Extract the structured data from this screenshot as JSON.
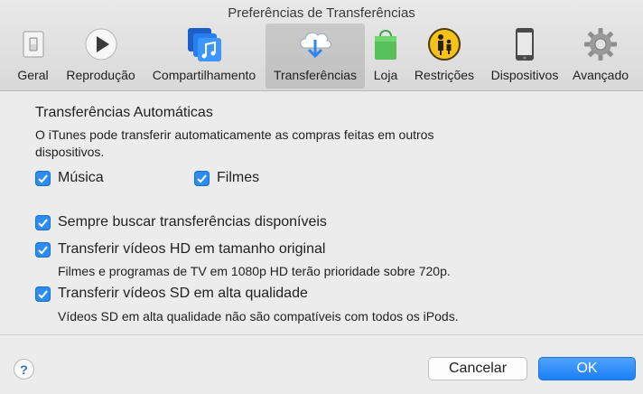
{
  "window": {
    "title": "Preferências de Transferências"
  },
  "tabs": [
    {
      "label": "Geral",
      "icon": "switch-icon",
      "active": false
    },
    {
      "label": "Reprodução",
      "icon": "play-icon",
      "active": false
    },
    {
      "label": "Compartilhamento",
      "icon": "sharing-music-icon",
      "active": false
    },
    {
      "label": "Transferências",
      "icon": "cloud-download-icon",
      "active": true
    },
    {
      "label": "Loja",
      "icon": "shopping-bag-icon",
      "active": false
    },
    {
      "label": "Restrições",
      "icon": "parental-restrictions-icon",
      "active": false
    },
    {
      "label": "Dispositivos",
      "icon": "phone-icon",
      "active": false
    },
    {
      "label": "Avançado",
      "icon": "gear-icon",
      "active": false
    }
  ],
  "auto": {
    "title": "Transferências Automáticas",
    "description": "O iTunes pode transferir automaticamente as compras feitas em outros dispositivos.",
    "music": {
      "label": "Música",
      "checked": true
    },
    "movies": {
      "label": "Filmes",
      "checked": true
    }
  },
  "options": {
    "always_check": {
      "label": "Sempre buscar transferências disponíveis",
      "checked": true
    },
    "hd": {
      "label": "Transferir vídeos HD em tamanho original",
      "checked": true,
      "note": "Filmes e programas de TV em 1080p HD terão prioridade sobre 720p."
    },
    "sd": {
      "label": "Transferir vídeos SD em alta qualidade",
      "checked": true,
      "note": "Vídeos SD em alta qualidade não são compatíveis com todos os iPods."
    }
  },
  "footer": {
    "help": "?",
    "cancel": "Cancelar",
    "ok": "OK"
  },
  "colors": {
    "accent": "#2d8cf0",
    "ok_button": "#1a7ff5"
  }
}
